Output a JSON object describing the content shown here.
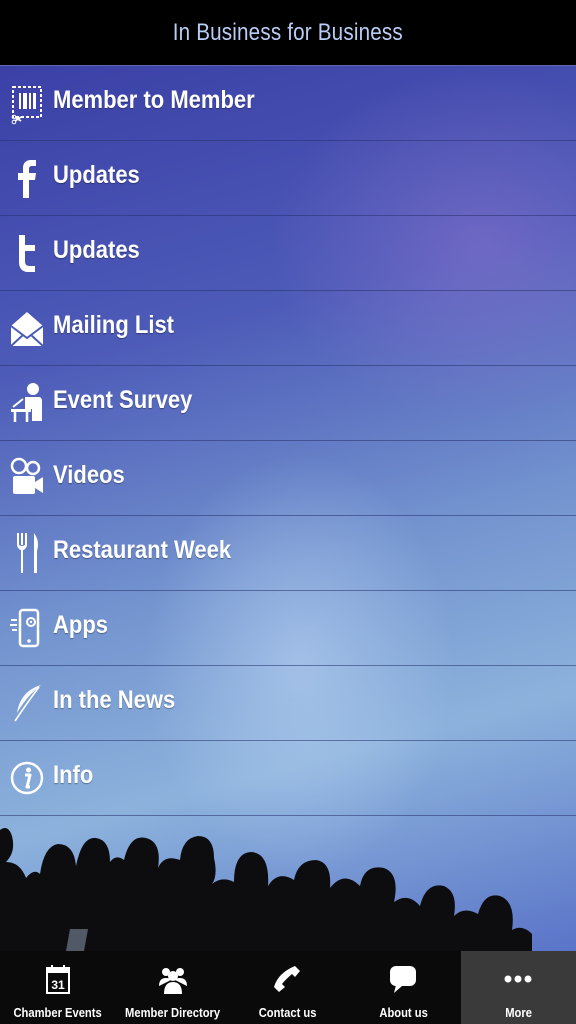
{
  "header": {
    "title": "In Business for Business"
  },
  "menu": {
    "items": [
      {
        "label": "Member to Member",
        "icon": "coupon-icon"
      },
      {
        "label": "Updates",
        "icon": "facebook-icon"
      },
      {
        "label": "Updates",
        "icon": "twitter-icon"
      },
      {
        "label": "Mailing List",
        "icon": "mail-icon"
      },
      {
        "label": "Event Survey",
        "icon": "survey-person-icon"
      },
      {
        "label": "Videos",
        "icon": "video-camera-icon"
      },
      {
        "label": "Restaurant Week",
        "icon": "fork-knife-icon"
      },
      {
        "label": "Apps",
        "icon": "mobile-app-icon"
      },
      {
        "label": "In the News",
        "icon": "quill-icon"
      },
      {
        "label": "Info",
        "icon": "info-icon"
      }
    ]
  },
  "tabbar": {
    "tabs": [
      {
        "label": "Chamber Events",
        "icon": "calendar-icon",
        "icon_text": "31",
        "active": false
      },
      {
        "label": "Member Directory",
        "icon": "people-icon",
        "active": false
      },
      {
        "label": "Contact us",
        "icon": "phone-icon",
        "active": false
      },
      {
        "label": "About us",
        "icon": "speech-bubble-icon",
        "active": false
      },
      {
        "label": "More",
        "icon": "more-dots-icon",
        "active": true
      }
    ]
  },
  "colors": {
    "header_bg": "#000000",
    "header_text": "#b9cdf5",
    "tabbar_bg": "#0a0a0a",
    "tab_active_bg": "#3a3a3a",
    "menu_text": "#ffffff"
  }
}
